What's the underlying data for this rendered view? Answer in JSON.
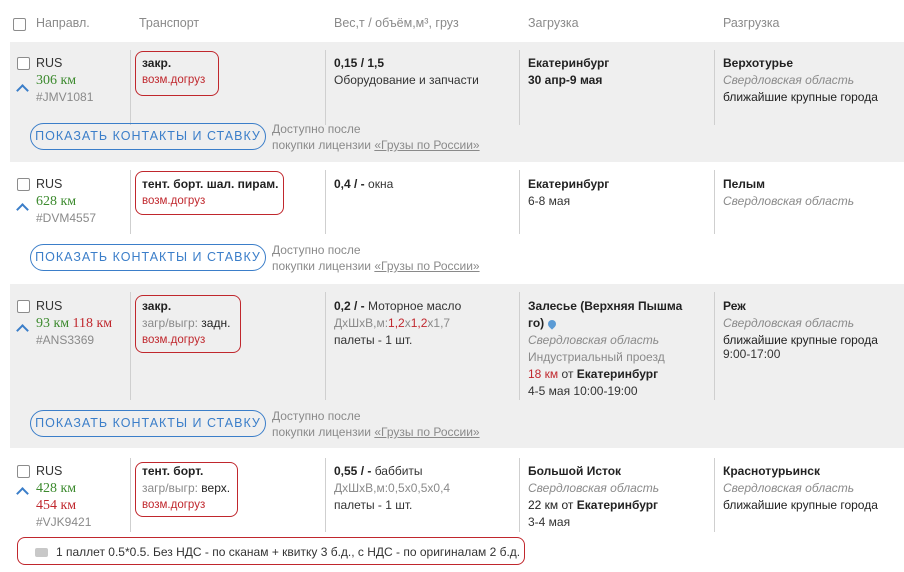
{
  "header": {
    "direction": "Направл.",
    "transport": "Транспорт",
    "weight": "Вес,т / объём,м³, груз",
    "loading": "Загрузка",
    "unloading": "Разгрузка"
  },
  "common": {
    "show_contacts_button": "ПОКАЗАТЬ КОНТАКТЫ И СТАВКУ",
    "available_after": "Доступно после",
    "purchase_license": "покупки лицензии",
    "license_link": "«Грузы по России»",
    "vozm_dogruz": "возм.догруз",
    "load_unload_label": "загр/выгр:"
  },
  "rows": [
    {
      "country": "RUS",
      "distance_1": "306 км",
      "id": "#JMV1081",
      "transport": "закр.",
      "weight": "0,15 / 1,5",
      "cargo": "Оборудование и запчасти",
      "load_city": "Екатеринбург",
      "load_date": "30 апр-9 мая",
      "unload_city": "Верхотурье",
      "unload_region": "Свердловская область",
      "unload_extra": "ближайшие крупные города"
    },
    {
      "country": "RUS",
      "distance_1": "628 км",
      "id": "#DVM4557",
      "transport": "тент. борт. шал. пирам.",
      "weight": "0,4 / -",
      "cargo": "окна",
      "load_city": "Екатеринбург",
      "load_date": "6-8 мая",
      "unload_city": "Пелым",
      "unload_region": "Свердловская область"
    },
    {
      "country": "RUS",
      "distance_1": "93 км",
      "distance_2": "118 км",
      "id": "#ANS3369",
      "transport": "закр.",
      "load_unload_value": "задн.",
      "weight": "0,2 / -",
      "cargo": "Моторное масло",
      "dims_label": "ДхШхВ,м:",
      "dim_a": "1,2",
      "dim_x1": "х",
      "dim_b": "1,2",
      "dim_x2": "х1,7",
      "packages": "палеты - 1 шт.",
      "load_city_1": "Залесье (Верхняя Пышма",
      "load_city_2": "го)",
      "load_region": "Свердловская область",
      "load_address": "Индустриальный проезд",
      "load_dist": "18 км",
      "load_from": "от",
      "load_from_city": "Екатеринбург",
      "load_date": "4-5 мая 10:00-19:00",
      "unload_city": "Реж",
      "unload_region": "Свердловская область",
      "unload_extra": "ближайшие крупные города",
      "unload_time": "9:00-17:00"
    },
    {
      "country": "RUS",
      "distance_1": "428 км",
      "distance_2": "454 км",
      "id": "#VJK9421",
      "transport": "тент. борт.",
      "load_unload_value": "верх.",
      "weight": "0,55 / -",
      "cargo": "баббиты",
      "dims": "ДхШхВ,м:0,5х0,5х0,4",
      "packages": "палеты - 1 шт.",
      "load_city": "Большой Исток",
      "load_region": "Свердловская область",
      "load_dist": "22 км от",
      "load_from_city": "Екатеринбург",
      "load_date": "3-4 мая",
      "unload_city": "Краснотурьинск",
      "unload_region": "Свердловская область",
      "unload_extra": "ближайшие крупные города",
      "comment": "1 паллет 0.5*0.5. Без НДС - по сканам + квитку 3 б.д., с НДС - по оригиналам 2 б.д."
    }
  ]
}
